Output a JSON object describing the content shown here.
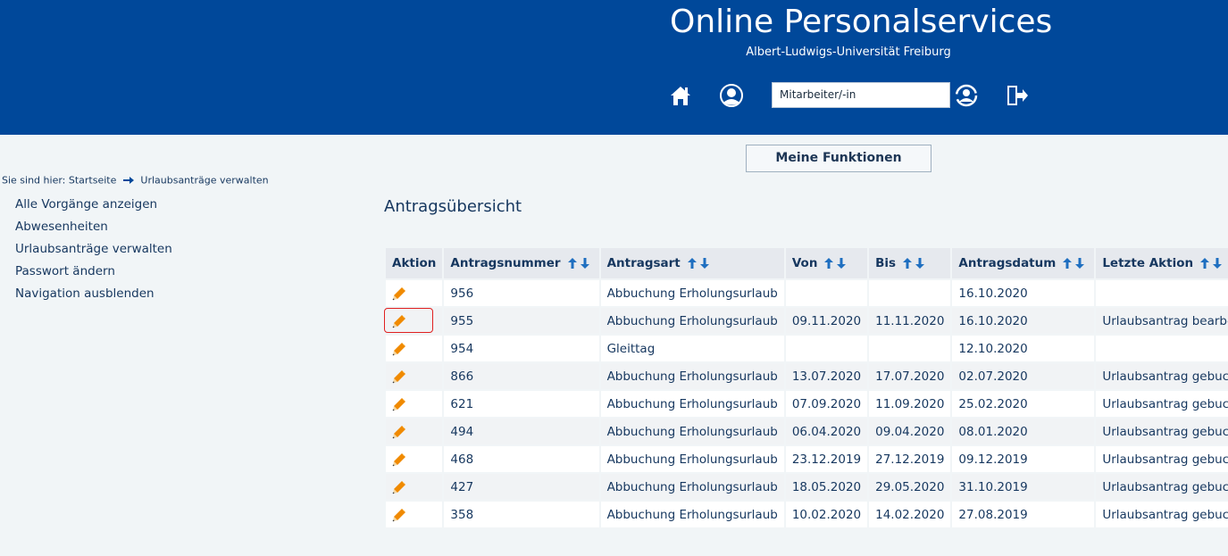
{
  "header": {
    "title": "Online Personalservices",
    "subtitle": "Albert-Ludwigs-Universität Freiburg",
    "role_select_value": "Mitarbeiter/-in",
    "icons": [
      "home-icon",
      "user-profile-icon",
      "switch-role-icon",
      "logout-icon"
    ],
    "background_color": "#00489a"
  },
  "meine_funktionen_label": "Meine Funktionen",
  "breadcrumb": {
    "prefix": "Sie sind hier:",
    "items": [
      "Startseite",
      "Urlaubsanträge verwalten"
    ]
  },
  "sidebar": {
    "items": [
      {
        "label": "Alle Vorgänge anzeigen"
      },
      {
        "label": "Abwesenheiten"
      },
      {
        "label": "Urlaubsanträge verwalten"
      },
      {
        "label": "Passwort ändern"
      },
      {
        "label": "Navigation ausblenden"
      }
    ]
  },
  "main": {
    "title": "Antragsübersicht",
    "table": {
      "columns": [
        "Aktion",
        "Antragsnummer",
        "Antragsart",
        "Von",
        "Bis",
        "Antragsdatum",
        "Letzte Aktion"
      ],
      "rows": [
        {
          "nummer": "956",
          "art": "Abbuchung Erholungsurlaub",
          "von": "",
          "bis": "",
          "datum": "16.10.2020",
          "letzte": ""
        },
        {
          "nummer": "955",
          "art": "Abbuchung Erholungsurlaub",
          "von": "09.11.2020",
          "bis": "11.11.2020",
          "datum": "16.10.2020",
          "letzte": "Urlaubsantrag bearbeitet"
        },
        {
          "nummer": "954",
          "art": "Gleittag",
          "von": "",
          "bis": "",
          "datum": "12.10.2020",
          "letzte": ""
        },
        {
          "nummer": "866",
          "art": "Abbuchung Erholungsurlaub",
          "von": "13.07.2020",
          "bis": "17.07.2020",
          "datum": "02.07.2020",
          "letzte": "Urlaubsantrag gebucht"
        },
        {
          "nummer": "621",
          "art": "Abbuchung Erholungsurlaub",
          "von": "07.09.2020",
          "bis": "11.09.2020",
          "datum": "25.02.2020",
          "letzte": "Urlaubsantrag gebucht"
        },
        {
          "nummer": "494",
          "art": "Abbuchung Erholungsurlaub",
          "von": "06.04.2020",
          "bis": "09.04.2020",
          "datum": "08.01.2020",
          "letzte": "Urlaubsantrag gebucht"
        },
        {
          "nummer": "468",
          "art": "Abbuchung Erholungsurlaub",
          "von": "23.12.2019",
          "bis": "27.12.2019",
          "datum": "09.12.2019",
          "letzte": "Urlaubsantrag gebucht"
        },
        {
          "nummer": "427",
          "art": "Abbuchung Erholungsurlaub",
          "von": "18.05.2020",
          "bis": "29.05.2020",
          "datum": "31.10.2019",
          "letzte": "Urlaubsantrag gebucht"
        },
        {
          "nummer": "358",
          "art": "Abbuchung Erholungsurlaub",
          "von": "10.02.2020",
          "bis": "14.02.2020",
          "datum": "27.08.2019",
          "letzte": "Urlaubsantrag gebucht"
        }
      ],
      "highlighted_row": "955"
    }
  },
  "colors": {
    "accent": "#00489a",
    "text": "#16375f",
    "edit_icon": "#f08a00",
    "highlight": "#e02020"
  }
}
